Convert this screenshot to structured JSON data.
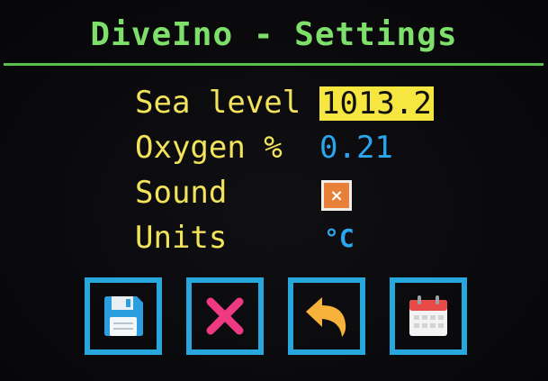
{
  "header": {
    "title": "DiveIno - Settings"
  },
  "settings": {
    "sea_level": {
      "label": "Sea level",
      "value": "1013.2"
    },
    "oxygen": {
      "label": "Oxygen %",
      "value": "0.21"
    },
    "sound": {
      "label": "Sound",
      "checkbox_mark": "×"
    },
    "units": {
      "label": "Units",
      "value": "°C"
    }
  },
  "toolbar": {
    "buttons": [
      {
        "icon": "save-icon"
      },
      {
        "icon": "close-icon"
      },
      {
        "icon": "undo-icon"
      },
      {
        "icon": "calendar-icon"
      }
    ]
  },
  "colors": {
    "title": "#7ee06a",
    "label": "#f2e35a",
    "value": "#2aa6ee",
    "highlight": "#f5e640",
    "button_border": "#28a7dc"
  }
}
